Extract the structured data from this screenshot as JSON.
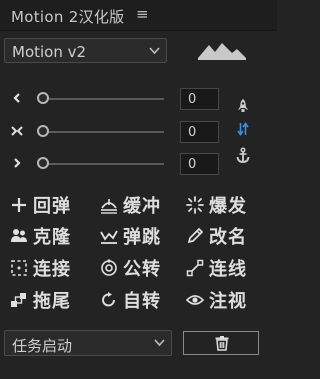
{
  "window": {
    "title": "Motion 2汉化版",
    "menu_glyph": "≡"
  },
  "preset_dropdown": {
    "selected": "Motion v2"
  },
  "sliders": [
    {
      "value": "0",
      "arrow": "chevron-left-icon"
    },
    {
      "value": "0",
      "arrow": "collapse-arrows-icon"
    },
    {
      "value": "0",
      "arrow": "chevron-right-icon"
    }
  ],
  "side_icons": [
    "rocket-icon",
    "sync-arrows-icon",
    "anchor-icon"
  ],
  "buttons": [
    {
      "label": "回弹",
      "icon": "plus-icon"
    },
    {
      "label": "缓冲",
      "icon": "ease-icon"
    },
    {
      "label": "爆发",
      "icon": "burst-icon"
    },
    {
      "label": "克隆",
      "icon": "clone-icon"
    },
    {
      "label": "弹跳",
      "icon": "bounce-icon"
    },
    {
      "label": "改名",
      "icon": "pencil-icon"
    },
    {
      "label": "连接",
      "icon": "link-dashed-icon"
    },
    {
      "label": "公转",
      "icon": "orbit-icon"
    },
    {
      "label": "连线",
      "icon": "line-connect-icon"
    },
    {
      "label": "拖尾",
      "icon": "trail-icon"
    },
    {
      "label": "自转",
      "icon": "rotate-icon"
    },
    {
      "label": "注视",
      "icon": "eye-icon"
    }
  ],
  "task_dropdown": {
    "selected": "任务启动"
  },
  "trash": {
    "icon": "trash-icon"
  },
  "colors": {
    "background": "#232323",
    "accent_blue": "#3d8fe0",
    "text": "#dedede"
  }
}
